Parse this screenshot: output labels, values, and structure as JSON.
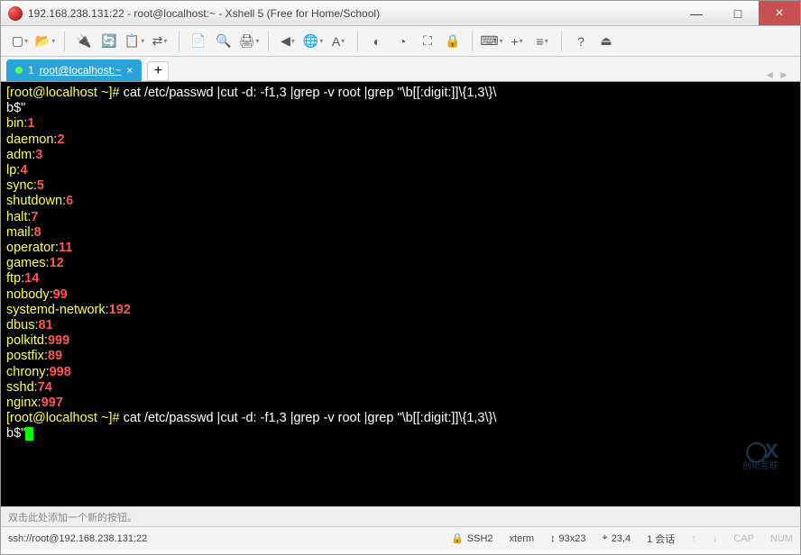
{
  "window": {
    "title": "192.168.238.131:22 - root@localhost:~ - Xshell 5 (Free for Home/School)",
    "min": "—",
    "max": "□",
    "close": "×"
  },
  "tab": {
    "index": "1",
    "label": "root@localhost:~",
    "close": "×",
    "plus": "+"
  },
  "tabnav": {
    "left": "◄",
    "right": "►"
  },
  "terminal": {
    "prompt1_a": "[root@localhost ~]# ",
    "cmd1": "cat /etc/passwd |cut -d: -f1,3 |grep -v root |grep \"\\b[[:digit:]]\\{1,3\\}\\\nb$\"",
    "output": [
      {
        "name": "bin",
        "uid": "1"
      },
      {
        "name": "daemon",
        "uid": "2"
      },
      {
        "name": "adm",
        "uid": "3"
      },
      {
        "name": "lp",
        "uid": "4"
      },
      {
        "name": "sync",
        "uid": "5"
      },
      {
        "name": "shutdown",
        "uid": "6"
      },
      {
        "name": "halt",
        "uid": "7"
      },
      {
        "name": "mail",
        "uid": "8"
      },
      {
        "name": "operator",
        "uid": "11"
      },
      {
        "name": "games",
        "uid": "12"
      },
      {
        "name": "ftp",
        "uid": "14"
      },
      {
        "name": "nobody",
        "uid": "99"
      },
      {
        "name": "systemd-network",
        "uid": "192"
      },
      {
        "name": "dbus",
        "uid": "81"
      },
      {
        "name": "polkitd",
        "uid": "999"
      },
      {
        "name": "postfix",
        "uid": "89"
      },
      {
        "name": "chrony",
        "uid": "998"
      },
      {
        "name": "sshd",
        "uid": "74"
      },
      {
        "name": "nginx",
        "uid": "997"
      }
    ],
    "prompt2_a": "[root@localhost ~]# ",
    "cmd2": "cat /etc/passwd |cut -d: -f1,3 |grep -v root |grep \"\\b[[:digit:]]\\{1,3\\}\\\nb$\""
  },
  "hint": "双击此处添加一个新的按钮。",
  "status": {
    "addr": "ssh://root@192.168.238.131:22",
    "ssh": "SSH2",
    "term": "xterm",
    "size": "93x23",
    "pos": "23,4",
    "sess": "1 会话",
    "up": "↑",
    "dn": "↓",
    "caps": "CAP",
    "num": "NUM"
  },
  "watermark": {
    "logo": "◯X",
    "text": "创新互联"
  }
}
